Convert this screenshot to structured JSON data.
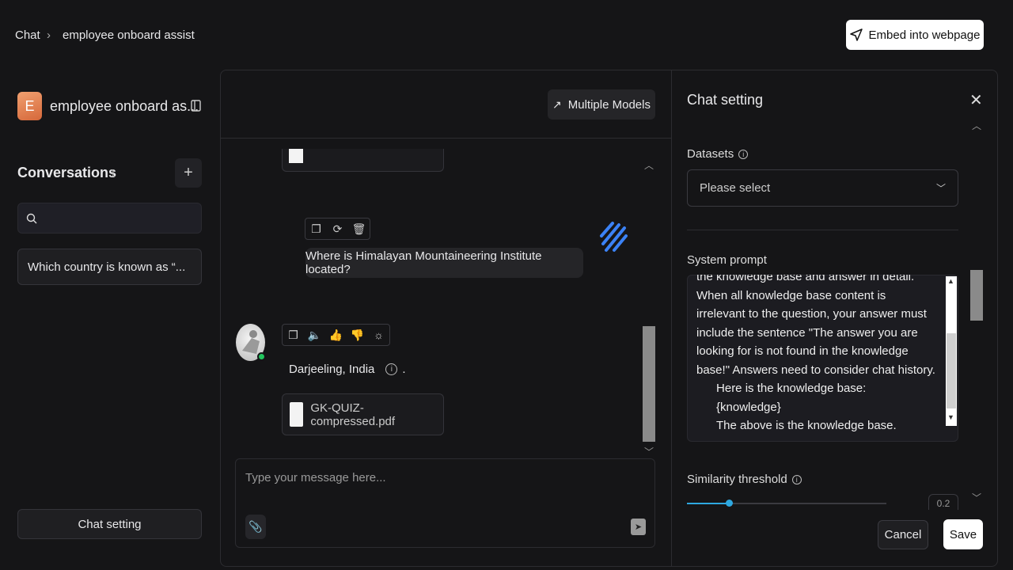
{
  "breadcrumb": {
    "root": "Chat",
    "separator": "›",
    "current": "employee onboard assist"
  },
  "header": {
    "embed_label": "Embed into webpage",
    "embed_icon": "send-icon"
  },
  "sidebar": {
    "app_initial": "E",
    "app_name": "employee onboard as...",
    "conversations_title": "Conversations",
    "conversations_count": "1",
    "add_icon": "+",
    "search_placeholder": "",
    "conversation_items": [
      "Which country is known as “..."
    ],
    "chat_setting_label": "Chat setting"
  },
  "chat": {
    "multiple_models_label": "Multiple Models",
    "user_message": "Where is Himalayan Mountaineering Institute located?",
    "bot_answer": "Darjeeling, India",
    "bot_answer_suffix": ".",
    "attachment_name": "GK-QUIZ-compressed.pdf",
    "input_placeholder": "Type your message here..."
  },
  "settings": {
    "title": "Chat setting",
    "datasets_label": "Datasets",
    "datasets_placeholder": "Please select",
    "system_prompt_label": "System prompt",
    "system_prompt_text": "the knowledge base and answer in detail. When all knowledge base content is irrelevant to the question, your answer must include the sentence \"The answer you are looking for is not found in the knowledge base!\" Answers need to consider chat history.\n      Here is the knowledge base:\n      {knowledge}\n      The above is the knowledge base.",
    "similarity_label": "Similarity threshold",
    "similarity_value": 0.2,
    "similarity_display": "0.2",
    "cancel_label": "Cancel",
    "save_label": "Save"
  },
  "colors": {
    "background": "#151517",
    "accent": "#2ea8e0",
    "online": "#22c55e",
    "app_avatar": "#e07a48"
  }
}
